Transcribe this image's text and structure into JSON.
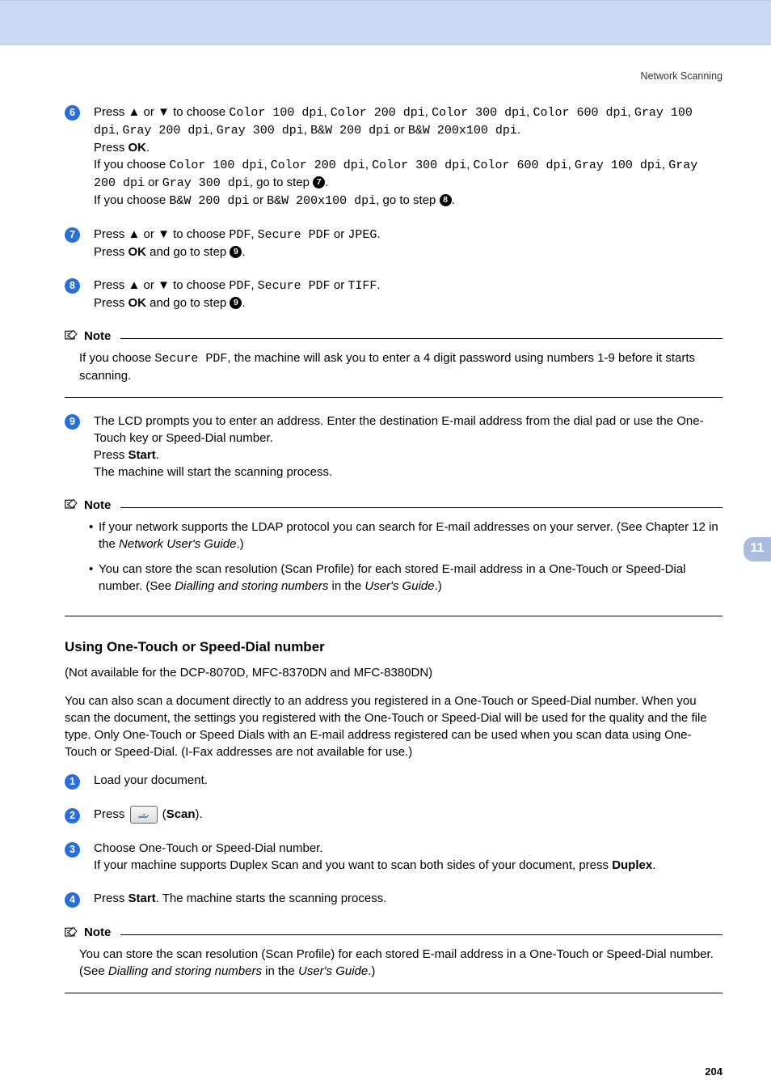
{
  "header": {
    "section": "Network Scanning"
  },
  "tab": {
    "number": "11"
  },
  "steps": {
    "s6": {
      "pre1": "Press ",
      "mid1": " or ",
      "mid2": " to choose ",
      "opt1": "Color 100 dpi",
      "opt2": "Color 200 dpi",
      "opt3": "Color 300 dpi",
      "opt4": "Color 600 dpi",
      "opt5": "Gray 100 dpi",
      "opt6": "Gray 200 dpi",
      "opt7": "Gray 300 dpi",
      "opt8": "B&W 200 dpi",
      "or": " or ",
      "opt9": "B&W 200x100 dpi",
      "pressOK": "Press ",
      "ok": "OK",
      "ifchoose": "If you choose ",
      "goto": ", go to step ",
      "ref7": "7",
      "ref8": "8"
    },
    "s7": {
      "pre1": "Press ",
      "mid1": " or ",
      "mid2": " to choose ",
      "opt1": "PDF",
      "opt2": "Secure PDF",
      "or": " or ",
      "opt3": "JPEG",
      "pressOK": "Press ",
      "ok": "OK",
      "andgoto": " and go to step ",
      "ref9": "9"
    },
    "s8": {
      "pre1": "Press ",
      "mid1": " or ",
      "mid2": " to choose ",
      "opt1": "PDF",
      "opt2": "Secure PDF",
      "or": " or ",
      "opt3": "TIFF",
      "pressOK": "Press ",
      "ok": "OK",
      "andgoto": " and go to step ",
      "ref9": "9"
    },
    "s9": {
      "line1": "The LCD prompts you to enter an address. Enter the destination E-mail address from the dial pad or use the One-Touch key or Speed-Dial number.",
      "pressStart": "Press ",
      "start": "Start",
      "line3": "The machine will start the scanning process."
    },
    "u1": {
      "text": "Load your document."
    },
    "u2": {
      "press": "Press ",
      "scan": "Scan"
    },
    "u3": {
      "l1": "Choose One-Touch or Speed-Dial number.",
      "l2a": "If your machine supports Duplex Scan and you want to scan both sides of your document, press ",
      "l2b": "Duplex"
    },
    "u4": {
      "press": "Press ",
      "start": "Start",
      "rest": ". The machine starts the scanning process."
    }
  },
  "notes": {
    "title": "Note",
    "n1": {
      "pre": "If you choose ",
      "secpdf": "Secure PDF",
      "post": ", the machine will ask you to enter a 4 digit password using numbers 1-9 before it starts scanning."
    },
    "n2": {
      "li1a": "If your network supports the LDAP protocol you can search for E-mail addresses on your server. (See Chapter 12 in the ",
      "li1b": "Network User's Guide",
      "li1c": ".)",
      "li2a": "You can store the scan resolution (Scan Profile) for each stored E-mail address in a One-Touch or Speed-Dial number. (See ",
      "li2b": "Dialling and storing numbers",
      "li2c": " in the ",
      "li2d": "User's Guide",
      "li2e": ".)"
    },
    "n3": {
      "a": "You can store the scan resolution (Scan Profile) for each stored E-mail address in a One-Touch or Speed-Dial number. (See ",
      "b": "Dialling and storing numbers",
      "c": " in the ",
      "d": "User's Guide",
      "e": ".)"
    }
  },
  "section": {
    "title": "Using One-Touch or Speed-Dial number",
    "avail": " (Not available for the DCP-8070D, MFC-8370DN and MFC-8380DN)",
    "intro": "You can also scan a document directly to an address you registered in a One-Touch or Speed-Dial number. When you scan the document, the settings you registered with the One-Touch or Speed-Dial will be used for the quality and the file type. Only One-Touch or Speed Dials with an E-mail address registered can be used when you scan data using One-Touch or Speed-Dial. (I-Fax addresses are not available for use.)"
  },
  "page": "204",
  "glyphs": {
    "up": "▲",
    "down": "▼",
    "comma": ", ",
    "period": "."
  }
}
